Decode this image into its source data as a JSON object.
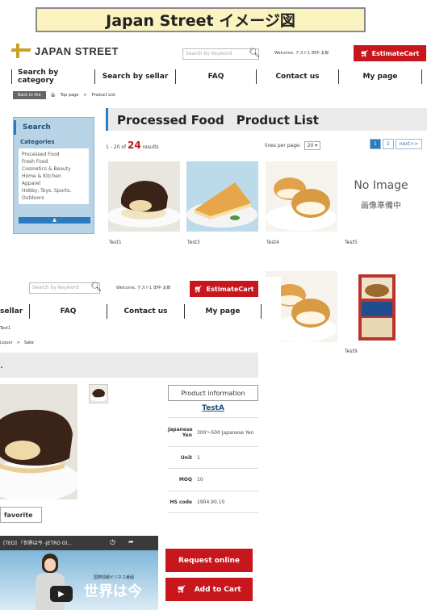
{
  "banner": {
    "title": "Japan Street イメージ図"
  },
  "back": {
    "logo": "JAPAN STREET",
    "search_placeholder": "Search by Keyword",
    "welcome": "Welcome, テスト1 田中 太郎",
    "estimate_cart": "EstimateCart",
    "nav": [
      "Search by category",
      "Search by sellar",
      "FAQ",
      "Contact us",
      "My page"
    ],
    "back_button": "Back to the",
    "breadcrumb": [
      "Top page",
      ">",
      "Product List"
    ],
    "sidebar": {
      "title": "Search",
      "categories_label": "Categories",
      "categories": [
        "Processed Food",
        "Fresh Food",
        "Cosmetics & Beauty",
        "Home & Kitchen",
        "Apparel",
        "Hobby, Toys, Sports, Outdoors"
      ],
      "collapse": "▲"
    },
    "page_title": "Processed Food　Product List",
    "results_prefix": "1 - 20 of",
    "results_count": "24",
    "results_suffix": "results",
    "lines_per_page_label": "lines per page:",
    "lines_per_page_value": "20 ▾",
    "pagination": [
      "1",
      "2",
      "next>>"
    ],
    "products": [
      {
        "label": "Test1"
      },
      {
        "label": "Test3"
      },
      {
        "label": "Test4"
      },
      {
        "label": "Test5"
      }
    ],
    "no_image_en": "No Image",
    "no_image_jp": "画像準備中",
    "second_row_labels": [
      "Test9"
    ]
  },
  "front": {
    "search_placeholder": "Search by Keyword",
    "welcome": "Welcome, テスト1 田中 太郎",
    "estimate_cart": "EstimateCart",
    "nav": [
      "sellar",
      "FAQ",
      "Contact us",
      "My page"
    ],
    "crumb1": "Test1",
    "crumb2": "Liquor　>　Sake",
    "product_info_label": "Product information",
    "product_name": "TestA",
    "rows": [
      {
        "k": "Japanese Yen",
        "v": "300～500 Japanese Yen"
      },
      {
        "k": "Unit",
        "v": "1"
      },
      {
        "k": "MOQ",
        "v": "10"
      },
      {
        "k": "HS code",
        "v": "1904.90.10"
      }
    ],
    "favorite": "favorite",
    "video_title": "[TEO] 「世界は今 -JETRO Gl...",
    "video_jp_big": "世界は今",
    "video_jp_small": "国際情報ビジネス番組",
    "request_online": "Request online",
    "add_to_cart": "Add to Cart"
  }
}
